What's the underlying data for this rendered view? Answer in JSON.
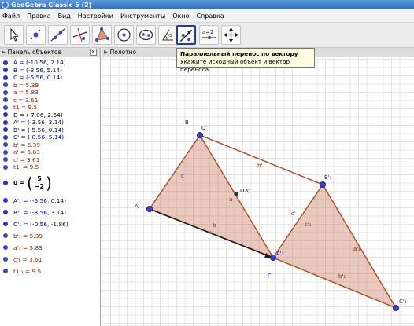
{
  "window": {
    "title": "GeoGebra Classic 5 (2)"
  },
  "menu": [
    "Файл",
    "Правка",
    "Вид",
    "Настройки",
    "Инструменты",
    "Окно",
    "Справка"
  ],
  "toolbar": {
    "tools": [
      {
        "name": "move-tool",
        "icon": "arrow-cursor-icon"
      },
      {
        "name": "point-tool",
        "icon": "point-icon"
      },
      {
        "name": "line-tool",
        "icon": "line-icon"
      },
      {
        "name": "perpendicular-tool",
        "icon": "perpendicular-icon"
      },
      {
        "name": "polygon-tool",
        "icon": "polygon-icon"
      },
      {
        "name": "circle-tool",
        "icon": "circle-icon"
      },
      {
        "name": "ellipse-tool",
        "icon": "ellipse-icon"
      },
      {
        "name": "angle-tool",
        "icon": "angle-icon"
      },
      {
        "name": "translate-by-vector-tool",
        "icon": "translate-vector-icon"
      },
      {
        "name": "slider-tool",
        "icon": "slider-icon"
      },
      {
        "name": "move-graphics-tool",
        "icon": "move-view-icon"
      }
    ],
    "slider_label": "a=2",
    "active_index": 8
  },
  "tooltip": {
    "title": "Параллельный перенос по вектору",
    "text": "Укажите исходный объект и вектор переноса"
  },
  "algebra": {
    "header": "Панель объектов",
    "items": [
      {
        "text": "A = (-10.56, 2.14)",
        "color": "blue"
      },
      {
        "text": "B = (-8.56, 5.14)",
        "color": "blue"
      },
      {
        "text": "C = (-5.56, 0.14)",
        "color": "blue"
      },
      {
        "text": "b = 5.39",
        "color": "red"
      },
      {
        "text": "a = 5.83",
        "color": "red"
      },
      {
        "text": "c = 3.61",
        "color": "red"
      },
      {
        "text": "t1 = 9.5",
        "color": "red"
      },
      {
        "text": "D = (-7.06, 2.64)",
        "color": "black"
      },
      {
        "text": "A' = (-3.56, 3.14)",
        "color": "blue"
      },
      {
        "text": "B' = (-5.56, 0.14)",
        "color": "blue"
      },
      {
        "text": "C' = (-8.56, 5.14)",
        "color": "blue"
      },
      {
        "text": "b' = 5.39",
        "color": "red"
      },
      {
        "text": "a' = 5.83",
        "color": "red"
      },
      {
        "text": "c' = 3.61",
        "color": "red"
      },
      {
        "text": "t1' = 9.5",
        "color": "red"
      }
    ],
    "vector": {
      "name": "u =",
      "x": "5",
      "y": "−2"
    },
    "items2": [
      {
        "text": "A'₁ = (-5.56, 0.14)",
        "color": "blue"
      },
      {
        "text": "B'₁ = (-3.56, 3.14)",
        "color": "blue"
      },
      {
        "text": "C'₁ = (-0.56, -1.86)",
        "color": "blue"
      },
      {
        "text": "b'₁ = 5.39",
        "color": "red"
      },
      {
        "text": "a'₁ = 5.83",
        "color": "red"
      },
      {
        "text": "c'₁ = 3.61",
        "color": "red"
      },
      {
        "text": "t1'₁ = 9.5",
        "color": "red"
      }
    ]
  },
  "graphics": {
    "header": "Полотно",
    "labels": {
      "A": "A",
      "B": "B",
      "C_prime": "C'",
      "C": "C",
      "D": "D",
      "a_prime_label": "a'",
      "a": "a",
      "b": "b",
      "c": "c",
      "u": "u",
      "b_prime": "b'",
      "c_prime": "c'",
      "B1": "B'₁",
      "A1": "A'₁",
      "c1": "c'₁",
      "a1": "a'₁",
      "b1": "b'₁",
      "C1": "C'₁"
    },
    "colors": {
      "fill": "#c9795a",
      "edge": "#a8562e",
      "point": "#3a3fd0",
      "vector": "#1a1a1a",
      "grid": "#e4e4e4"
    }
  }
}
